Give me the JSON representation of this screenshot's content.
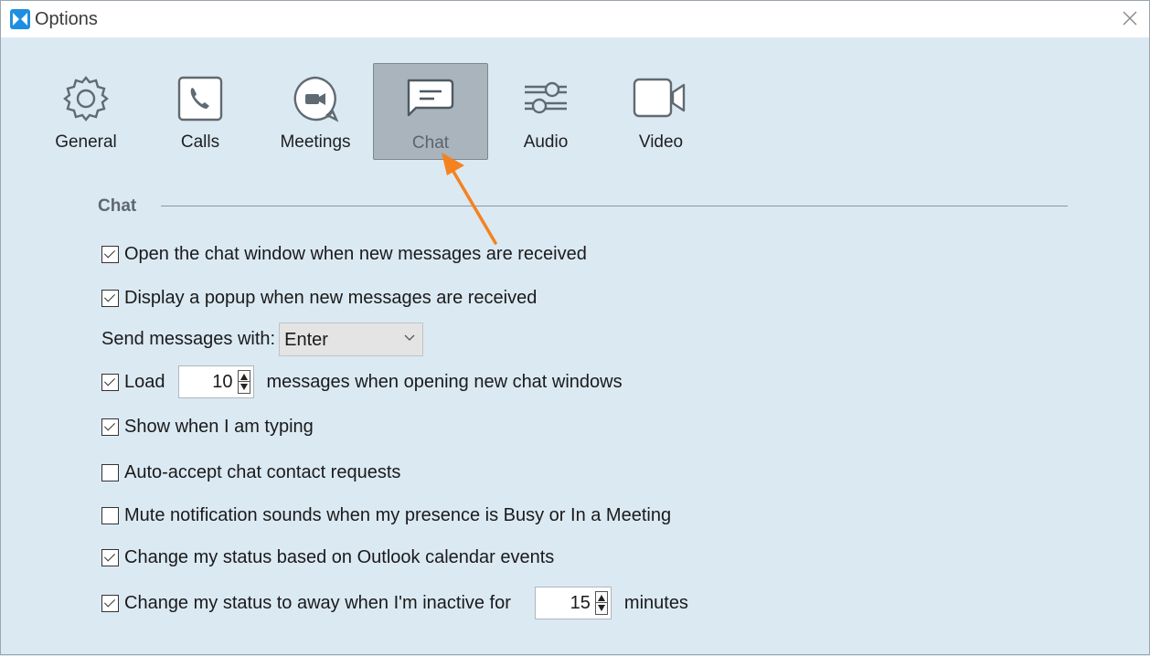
{
  "window": {
    "title": "Options"
  },
  "toolbar": {
    "items": [
      {
        "label": "General",
        "icon": "gear-icon",
        "selected": false
      },
      {
        "label": "Calls",
        "icon": "phone-icon",
        "selected": false
      },
      {
        "label": "Meetings",
        "icon": "video-bubble-icon",
        "selected": false
      },
      {
        "label": "Chat",
        "icon": "chat-bubble-icon",
        "selected": true
      },
      {
        "label": "Audio",
        "icon": "sliders-icon",
        "selected": false
      },
      {
        "label": "Video",
        "icon": "video-camera-icon",
        "selected": false
      }
    ]
  },
  "section": {
    "title": "Chat"
  },
  "options": {
    "open_window": {
      "label": "Open the chat window when new messages are received",
      "checked": true
    },
    "display_popup": {
      "label": "Display a popup when new messages are received",
      "checked": true
    },
    "send_with": {
      "label": "Send messages with:",
      "value": "Enter"
    },
    "load": {
      "prefix": "Load",
      "value": "10",
      "suffix": "messages when opening new chat windows",
      "checked": true
    },
    "show_typing": {
      "label": "Show when I am typing",
      "checked": true
    },
    "auto_accept": {
      "label": "Auto-accept chat contact requests",
      "checked": false
    },
    "mute_sounds": {
      "label": "Mute notification sounds when my presence is Busy or In a Meeting",
      "checked": false
    },
    "outlook_status": {
      "label": "Change my status based on Outlook calendar events",
      "checked": true
    },
    "away": {
      "prefix": "Change my status to away when I'm inactive for",
      "value": "15",
      "suffix": "minutes",
      "checked": true
    }
  },
  "colors": {
    "accent_arrow": "#f5821f",
    "logo": "#1e8fe0",
    "background": "#dbe9f3"
  }
}
